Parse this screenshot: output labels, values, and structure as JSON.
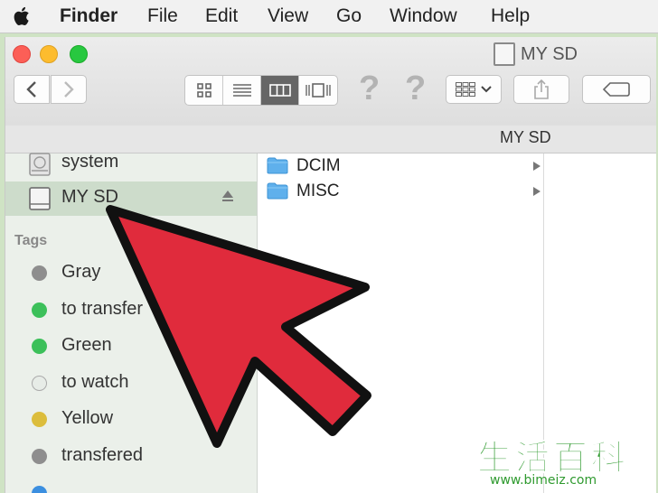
{
  "menubar": {
    "items": [
      "Finder",
      "File",
      "Edit",
      "View",
      "Go",
      "Window",
      "Help"
    ]
  },
  "window": {
    "title": "MY SD",
    "path_title": "MY SD",
    "help_glyph_1": "?",
    "help_glyph_2": "?"
  },
  "sidebar": {
    "devices": [
      {
        "label": "system",
        "icon": "hard-drive-icon"
      },
      {
        "label": "MY SD",
        "icon": "sd-drive-icon",
        "selected": true
      }
    ],
    "tags_heading": "Tags",
    "tags": [
      {
        "label": "Gray",
        "color": "#8e8e8e"
      },
      {
        "label": "to transfer",
        "color": "#3cc05a"
      },
      {
        "label": "Green",
        "color": "#3cc05a"
      },
      {
        "label": "to watch",
        "color": "#dfe6df"
      },
      {
        "label": "Yellow",
        "color": "#dcbd3c"
      },
      {
        "label": "transfered",
        "color": "#8e8e8e"
      }
    ]
  },
  "files": [
    {
      "name": "DCIM",
      "icon": "folder-icon"
    },
    {
      "name": "MISC",
      "icon": "folder-icon"
    }
  ],
  "overlay": {
    "arrow_color": "#e02b3c",
    "watermark_cn": "生活百科",
    "watermark_url": "www.bimeiz.com"
  }
}
